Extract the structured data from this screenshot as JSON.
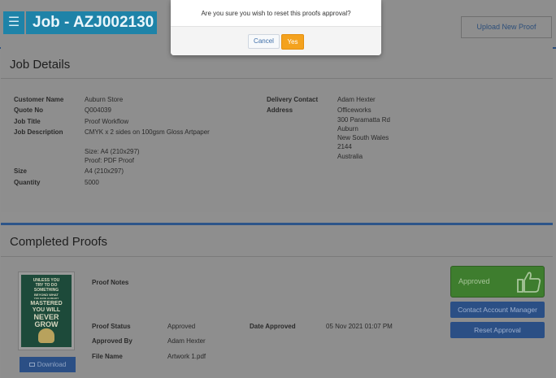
{
  "header": {
    "menu_icon": "☰",
    "job_title": "Job - AZJ002130",
    "upload_label": "Upload New Proof"
  },
  "job_details": {
    "title": "Job Details",
    "left": [
      {
        "label": "Customer Name",
        "value": "Auburn Store"
      },
      {
        "label": "Quote No",
        "value": "Q004039"
      },
      {
        "label": "Job Title",
        "value": "Proof Workflow"
      },
      {
        "label": "Job Description",
        "value": "CMYK x 2 sides on 100gsm Gloss Artpaper"
      }
    ],
    "description_extra": [
      "Size: A4 (210x297)",
      "Proof: PDF Proof"
    ],
    "size": {
      "label": "Size",
      "value": "A4 (210x297)"
    },
    "quantity": {
      "label": "Quantity",
      "value": "5000"
    },
    "delivery_contact": {
      "label": "Delivery Contact",
      "value": "Adam Hexter"
    },
    "address": {
      "label": "Address",
      "lines": [
        "Officeworks",
        "300 Paramatta Rd",
        "Auburn",
        "New South Wales",
        "2144",
        "Australia"
      ]
    }
  },
  "completed_proofs": {
    "title": "Completed Proofs",
    "poster_lines": [
      "UNLESS YOU",
      "TRY TO DO",
      "SOMETHING",
      "BEYOND WHAT",
      "YOU HAVE ALREADY",
      "MASTERED",
      "YOU WILL",
      "NEVER",
      "GROW"
    ],
    "download_label": "Download",
    "proof_notes_label": "Proof Notes",
    "proof_status": {
      "label": "Proof Status",
      "value": "Approved"
    },
    "approved_by": {
      "label": "Approved By",
      "value": "Adam Hexter"
    },
    "file_name": {
      "label": "File Name",
      "value": "Artwork 1.pdf"
    },
    "date_approved": {
      "label": "Date Approved",
      "value": "05 Nov 2021 01:07 PM"
    },
    "approved_badge": "Approved",
    "contact_button": "Contact Account Manager",
    "reset_button": "Reset Approval"
  },
  "modal": {
    "message": "Are you sure you wish to reset this proofs approval?",
    "cancel_label": "Cancel",
    "yes_label": "Yes"
  },
  "colors": {
    "accent_blue": "#1e83a8",
    "primary_button": "#2b4f85",
    "approved_green": "#3e7d2e",
    "warning_orange": "#f4a21e"
  }
}
